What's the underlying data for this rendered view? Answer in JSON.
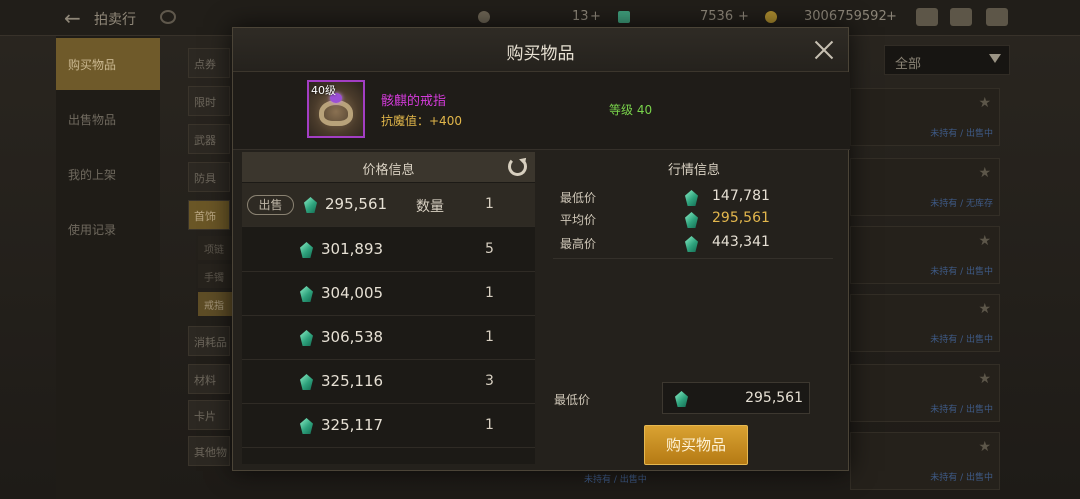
{
  "background": {
    "screen_title": "拍卖行",
    "resources": [
      {
        "icon": "moon-icon",
        "value": "13"
      },
      {
        "icon": "green-gem-icon",
        "value": "7536"
      },
      {
        "icon": "gold-coin-icon",
        "value": "3006759592"
      }
    ],
    "nav": [
      "购买物品",
      "出售物品",
      "我的上架",
      "使用记录"
    ],
    "categories": [
      "点券",
      "限时",
      "武器",
      "防具",
      "首饰",
      "消耗品",
      "材料",
      "卡片",
      "其他物"
    ],
    "sub_categories": [
      "项链",
      "手镯",
      "戒指"
    ],
    "filter": "全部",
    "card_tags": [
      "未持有 / 出售中",
      "未持有 / 无库存",
      "未持有 / 出售中",
      "未持有 / 出售中",
      "未持有 / 出售中",
      "未持有 / 出售中",
      "未持有 / 出售中"
    ]
  },
  "modal": {
    "title": "购买物品",
    "item": {
      "level_badge": "40级",
      "name": "骸麒的戒指",
      "stat": "抗魔值：+400",
      "grade": "等级 40"
    },
    "price_panel": {
      "title": "价格信息",
      "sell_tag": "出售",
      "qty_label": "数量",
      "rows": [
        {
          "price": "295,561",
          "qty": "1"
        },
        {
          "price": "301,893",
          "qty": "5"
        },
        {
          "price": "304,005",
          "qty": "1"
        },
        {
          "price": "306,538",
          "qty": "1"
        },
        {
          "price": "325,116",
          "qty": "3"
        },
        {
          "price": "325,117",
          "qty": "1"
        }
      ]
    },
    "market_panel": {
      "title": "行情信息",
      "lowest_label": "最低价",
      "lowest": "147,781",
      "average_label": "平均价",
      "average": "295,561",
      "highest_label": "最高价",
      "highest": "443,341",
      "min_price_label": "最低价",
      "min_price_value": "295,561"
    },
    "buy_button": "购买物品"
  }
}
